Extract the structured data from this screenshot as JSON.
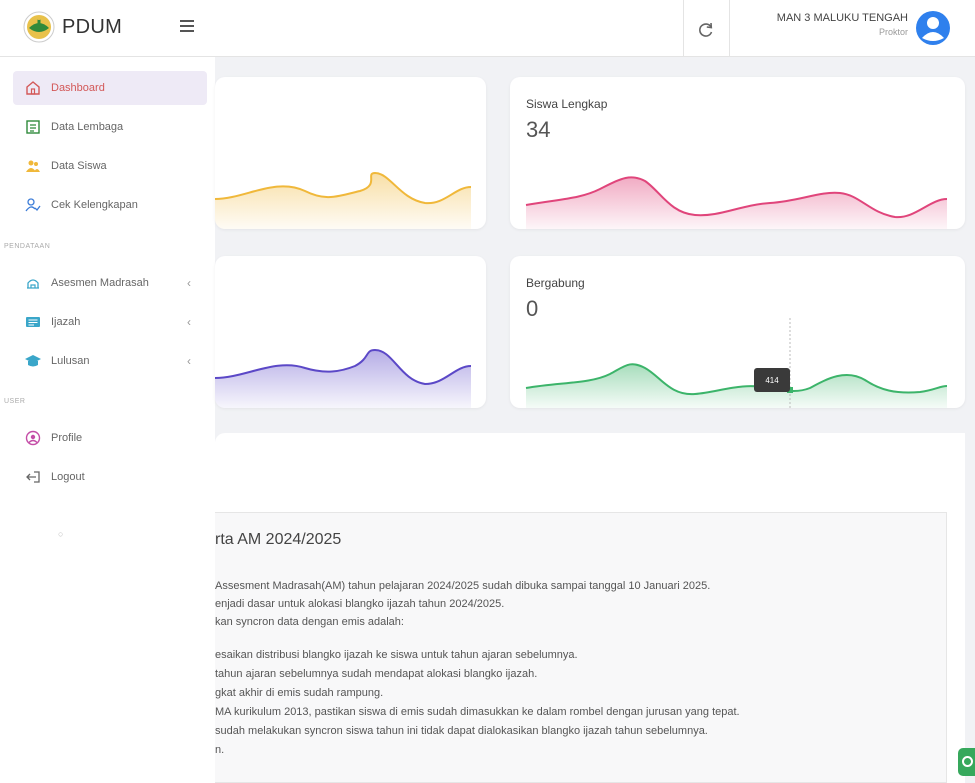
{
  "app": {
    "name": "PDUM"
  },
  "header": {
    "user_name": "MAN 3 MALUKU TENGAH",
    "user_role": "Proktor"
  },
  "sidebar": {
    "items": [
      {
        "label": "Dashboard",
        "icon": "home-icon",
        "active": true
      },
      {
        "label": "Data Lembaga",
        "icon": "building-icon"
      },
      {
        "label": "Data Siswa",
        "icon": "users-icon"
      },
      {
        "label": "Cek Kelengkapan",
        "icon": "user-check-icon"
      }
    ],
    "section_pendataan": "PENDATAAN",
    "pendataan_items": [
      {
        "label": "Asesmen Madrasah",
        "icon": "mosque-icon",
        "arrow": "‹"
      },
      {
        "label": "Ijazah",
        "icon": "certificate-icon",
        "arrow": "‹"
      },
      {
        "label": "Lulusan",
        "icon": "graduation-cap-icon",
        "arrow": "‹"
      }
    ],
    "section_user": "USER",
    "user_items": [
      {
        "label": "Profile",
        "icon": "profile-icon"
      },
      {
        "label": "Logout",
        "icon": "logout-icon"
      }
    ],
    "bottom_mark": "○"
  },
  "cards": [
    {
      "title": "Siswa Lengkap",
      "value": "34",
      "color": "#e0457b"
    },
    {
      "title": "Bergabung",
      "value": "0",
      "color": "#3cb46a"
    },
    {
      "title": "",
      "value": "",
      "color": "#f0b83a"
    },
    {
      "title": "",
      "value": "",
      "color": "#5b48c7"
    }
  ],
  "tooltip": {
    "value": "414"
  },
  "notice": {
    "title": "rta AM 2024/2025",
    "lines": [
      "Assesment Madrasah(AM) tahun pelajaran 2024/2025 sudah dibuka sampai tanggal 10 Januari 2025.",
      "enjadi dasar untuk alokasi blangko ijazah tahun 2024/2025.",
      "kan syncron data dengan emis adalah:",
      "esaikan distribusi blangko ijazah ke siswa untuk tahun ajaran sebelumnya.",
      "tahun ajaran sebelumnya sudah mendapat alokasi blangko ijazah.",
      "gkat akhir di emis sudah rampung.",
      "MA kurikulum 2013, pastikan siswa di emis sudah dimasukkan ke dalam rombel dengan jurusan yang tepat.",
      " sudah melakukan syncron siswa tahun ini tidak dapat dialokasikan blangko ijazah tahun sebelumnya.",
      "n."
    ]
  },
  "colors": {
    "accent": "#d35858",
    "active_bg": "#eeeaf6",
    "avatar": "#2f80ed"
  }
}
